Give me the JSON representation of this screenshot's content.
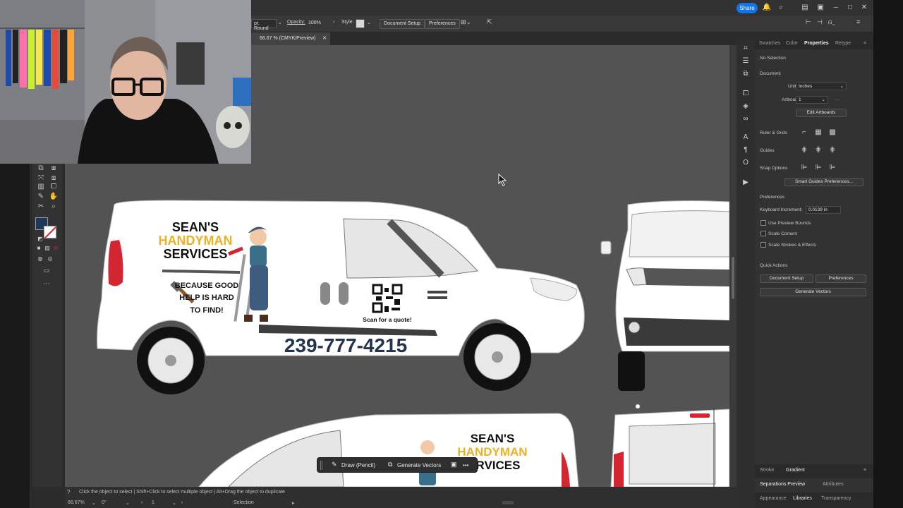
{
  "control_bar": {
    "stroke_profile": "pt. Round",
    "opacity_label": "Opacity:",
    "opacity_value": "100%",
    "style_label": "Style:",
    "document_setup": "Document Setup",
    "preferences": "Preferences"
  },
  "top_bar": {
    "share_label": "Share"
  },
  "document_tab": {
    "title": "66.67 % (CMYK/Preview)"
  },
  "properties_panel": {
    "tabs": [
      "Swatches",
      "Color",
      "Properties",
      "Retype"
    ],
    "active_tab": "Properties",
    "selection": "No Selection",
    "document_header": "Document",
    "units_label": "Units:",
    "units_value": "Inches",
    "artboard_label": "Artboard:",
    "artboard_value": "1",
    "edit_artboards": "Edit Artboards",
    "ruler_grids": "Ruler & Grids",
    "guides": "Guides",
    "snap_options": "Snap Options",
    "smart_guides_prefs": "Smart Guides Preferences...",
    "preferences_header": "Preferences",
    "keyboard_increment_label": "Keyboard Increment:",
    "keyboard_increment_value": "0.0139 in",
    "use_preview_bounds": "Use Preview Bounds",
    "scale_corners": "Scale Corners",
    "scale_strokes": "Scale Strokes & Effects",
    "quick_actions_header": "Quick Actions",
    "qa_document_setup": "Document Setup",
    "qa_preferences": "Preferences",
    "qa_generate_vectors": "Generate Vectors"
  },
  "bottom_panels": {
    "row1": [
      "Stroke",
      "Gradient"
    ],
    "row1_active": "Gradient",
    "row2": [
      "Separations Preview",
      "Attributes"
    ],
    "row2_active": "Separations Preview",
    "row3": [
      "Appearance",
      "Libraries",
      "Transparency"
    ],
    "row3_active": "Libraries"
  },
  "status_bar": {
    "hint": "Click the object to select  |  Shift+Click to select multiple object  |  Alt+Drag the object to duplicate",
    "zoom": "66.67%",
    "rotation": "0°",
    "artboard": "1",
    "tool": "Selection"
  },
  "task_bar": {
    "draw_label": "Draw (Pencil)",
    "generate_label": "Generate Vectors",
    "more": "•••"
  },
  "artwork": {
    "brand_line1": "SEAN'S",
    "brand_line2": "HANDYMAN",
    "brand_line3": "SERVICES",
    "tagline1": "BECAUSE GOOD",
    "tagline2": "HELP IS HARD",
    "tagline3": "TO FIND!",
    "qr_caption": "Scan for a quote!",
    "phone": "239-777-4215",
    "bottom_brand1": "SEAN'S",
    "bottom_brand2": "HANDYMAN",
    "bottom_brand3": "RVICES"
  },
  "colors": {
    "accent": "#1473e6",
    "brand_gold": "#e9b227",
    "phone_navy": "#24344f",
    "tail_red": "#d42533",
    "fill_swatch": "#1e3a5a"
  }
}
